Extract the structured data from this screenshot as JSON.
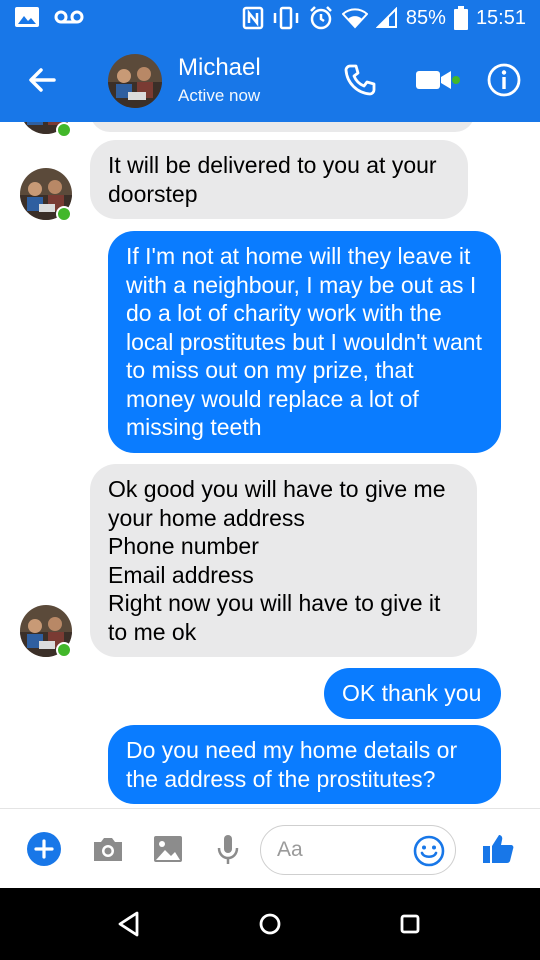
{
  "status_bar": {
    "battery": "85%",
    "time": "15:51",
    "icons": [
      "gallery-icon",
      "voicemail-icon",
      "nfc-icon",
      "vibrate-icon",
      "alarm-icon",
      "wifi-icon",
      "signal-icon",
      "battery-icon"
    ]
  },
  "header": {
    "name": "Michael",
    "status": "Active now",
    "icons": [
      "back-arrow-icon",
      "phone-icon",
      "video-camera-icon",
      "info-icon"
    ],
    "accent": "#1877e8"
  },
  "messages": [
    {
      "side": "in",
      "text": "It will be delivered to you at your doorstep"
    },
    {
      "side": "out",
      "text": "If I'm not at home will they leave it with a neighbour, I may be out as I do a lot of charity work with the local prostitutes but I wouldn't want to miss out on my prize, that money would replace a lot of missing teeth"
    },
    {
      "side": "in",
      "text": "Ok good you will have to give me your home address\nPhone number\nEmail address\nRight now you will have to give it to me ok"
    },
    {
      "side": "out",
      "text": "OK thank you"
    },
    {
      "side": "out",
      "text": "Do you need my home details or the address of the prostitutes?"
    }
  ],
  "composer": {
    "placeholder": "Aa",
    "icons": [
      "plus-icon",
      "camera-icon",
      "image-icon",
      "microphone-icon",
      "emoji-icon",
      "thumbs-up-icon"
    ]
  },
  "navbar": {
    "icons": [
      "back-triangle-icon",
      "home-circle-icon",
      "recents-square-icon"
    ]
  },
  "colors": {
    "outgoing_bubble": "#0a7cff",
    "incoming_bubble": "#e9e9ea",
    "online_dot": "#42b72a"
  }
}
